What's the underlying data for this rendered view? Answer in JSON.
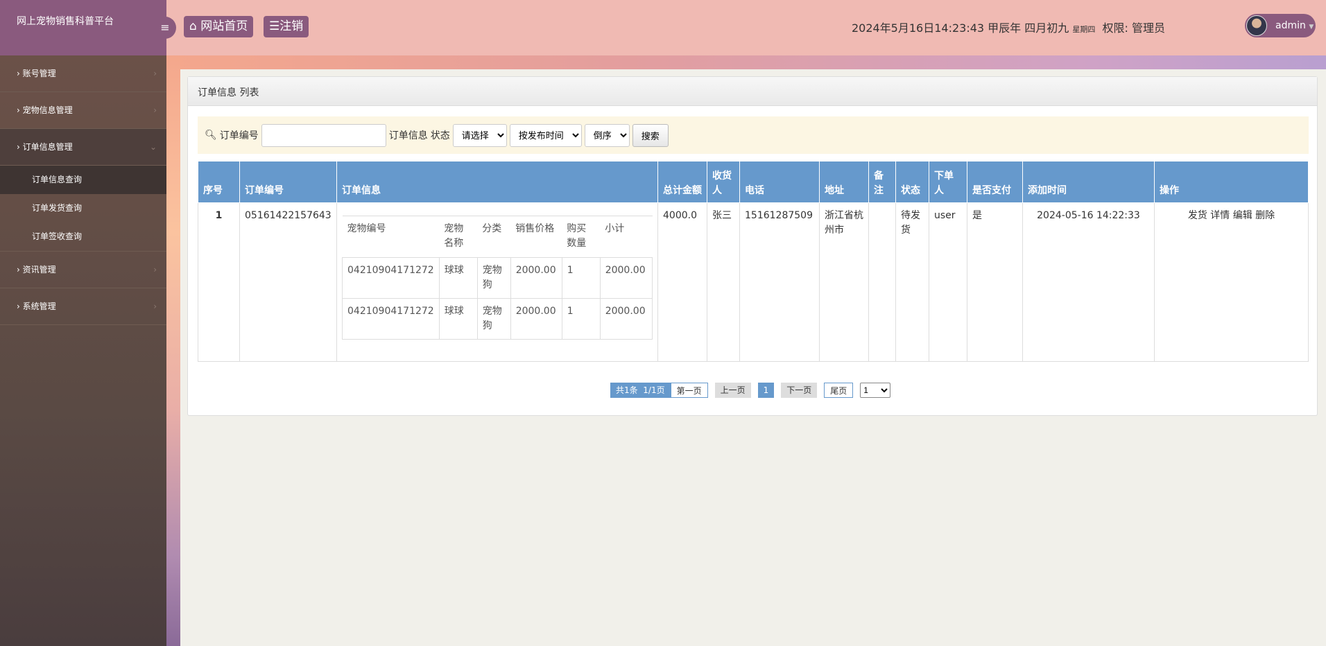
{
  "app": {
    "title": "网上宠物销售科普平台"
  },
  "topbar": {
    "home": "网站首页",
    "logout": "注销",
    "datetime": "2024年5月16日14:23:43 甲辰年 四月初九",
    "weekday": "星期四",
    "role": "权限: 管理员",
    "user": "admin"
  },
  "sidebar": {
    "items": [
      {
        "label": "账号管理"
      },
      {
        "label": "宠物信息管理"
      },
      {
        "label": "订单信息管理",
        "sub": [
          "订单信息查询",
          "订单发货查询",
          "订单签收查询"
        ]
      },
      {
        "label": "资讯管理"
      },
      {
        "label": "系统管理"
      }
    ]
  },
  "panel": {
    "title": "订单信息 列表"
  },
  "search": {
    "order_no_label": "订单编号",
    "order_no_value": "",
    "info_label": "订单信息",
    "status_label": "状态",
    "status_select": "请选择",
    "sort_select": "按发布时间",
    "order_select": "倒序",
    "button": "搜索"
  },
  "table": {
    "headers": [
      "序号",
      "订单编号",
      "订单信息",
      "总计金额",
      "收货人",
      "电话",
      "地址",
      "备注",
      "状态",
      "下单人",
      "是否支付",
      "添加时间",
      "操作"
    ],
    "rows": [
      {
        "index": "1",
        "order_no": "05161422157643",
        "total": "4000.0",
        "receiver": "张三",
        "phone": "15161287509",
        "address": "浙江省杭州市",
        "note": "",
        "status": "待发货",
        "user": "user",
        "paid": "是",
        "time": "2024-05-16 14:22:33",
        "items_headers": [
          "宠物编号",
          "宠物名称",
          "分类",
          "销售价格",
          "购买数量",
          "小计"
        ],
        "items": [
          [
            "04210904171272",
            "球球",
            "宠物狗",
            "2000.00",
            "1",
            "2000.00"
          ],
          [
            "04210904171272",
            "球球",
            "宠物狗",
            "2000.00",
            "1",
            "2000.00"
          ]
        ]
      }
    ],
    "actions": [
      "发货",
      "详情",
      "编辑",
      "删除"
    ]
  },
  "pager": {
    "summary": "共1条  1/1页",
    "first": "第一页",
    "prev": "上一页",
    "current": "1",
    "next": "下一页",
    "last": "尾页",
    "jump": "1"
  }
}
